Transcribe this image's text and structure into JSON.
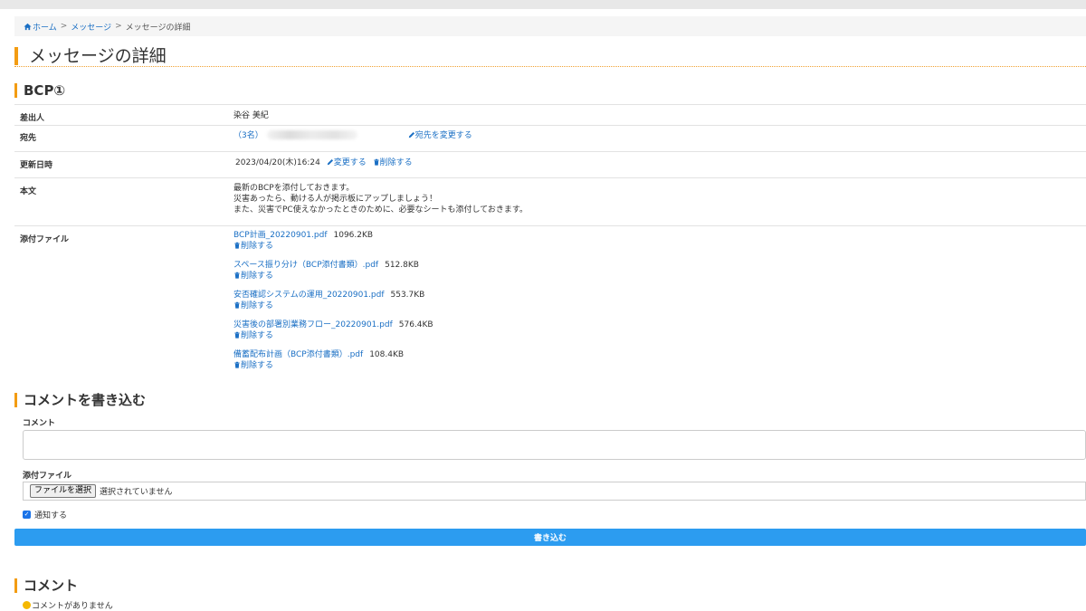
{
  "breadcrumb": {
    "home": "ホーム",
    "sep1": ">",
    "messages": "メッセージ",
    "sep2": ">",
    "current": "メッセージの詳細"
  },
  "page_title": "メッセージの詳細",
  "message": {
    "subject": "BCP①",
    "sender_label": "差出人",
    "sender_name": "染谷 美紀",
    "recipient_label": "宛先",
    "recipient_count": "（3名）",
    "change_recipients": "宛先を変更する",
    "updated_label": "更新日時",
    "updated_value": "2023/04/20(木)16:24",
    "edit_link": "変更する",
    "delete_link": "削除する",
    "body_label": "本文",
    "body_lines": [
      "最新のBCPを添付しておきます。",
      "災害あったら、動ける人が掲示板にアップしましょう！",
      "また、災害でPC使えなかったときのために、必要なシートも添付しておきます。"
    ],
    "attachments_label": "添付ファイル",
    "attachments": [
      {
        "name": "BCP計画_20220901.pdf",
        "size": "1096.2KB",
        "delete": "削除する"
      },
      {
        "name": "スペース振り分け（BCP添付書類）.pdf",
        "size": "512.8KB",
        "delete": "削除する"
      },
      {
        "name": "安否確認システムの運用_20220901.pdf",
        "size": "553.7KB",
        "delete": "削除する"
      },
      {
        "name": "災害後の部署別業務フロー_20220901.pdf",
        "size": "576.4KB",
        "delete": "削除する"
      },
      {
        "name": "備蓄配布計画（BCP添付書類）.pdf",
        "size": "108.4KB",
        "delete": "削除する"
      }
    ]
  },
  "comment_form": {
    "heading": "コメントを書き込む",
    "comment_label": "コメント",
    "comment_value": "",
    "file_label": "添付ファイル",
    "file_button": "ファイルを選択",
    "file_status": "選択されていません",
    "notify_label": "通知する",
    "notify_checked": true,
    "submit_label": "書き込む"
  },
  "comments": {
    "heading": "コメント",
    "empty_text": "コメントがありません"
  },
  "colors": {
    "accent": "#f39c12",
    "link": "#1a6fc4",
    "button": "#2c9cf0"
  }
}
